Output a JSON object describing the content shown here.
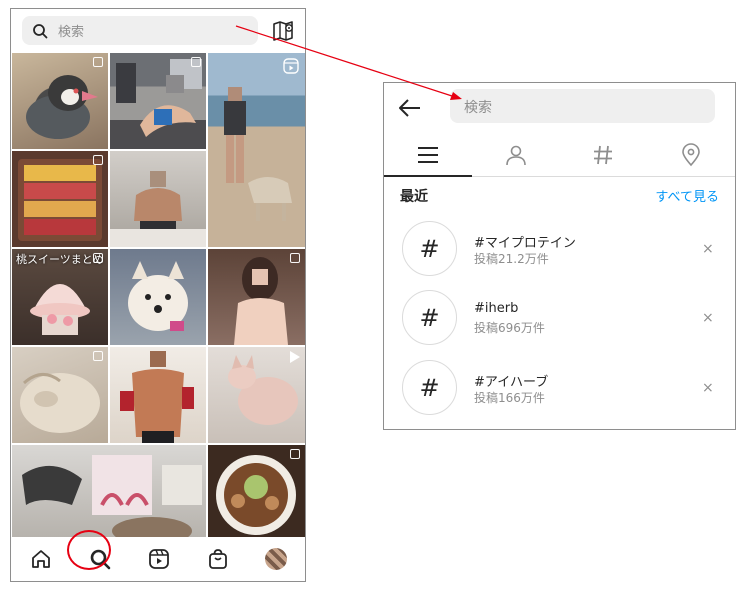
{
  "left_screen": {
    "search_placeholder": "検索",
    "tile_caption": "桃スイーツまとめ",
    "bottom_nav": [
      "home-icon",
      "search-icon",
      "reels-icon",
      "shop-icon",
      "profile-avatar"
    ]
  },
  "right_panel": {
    "search_placeholder": "検索",
    "tabs": [
      "top-icon",
      "accounts-icon",
      "tags-icon",
      "places-icon"
    ],
    "recent_label": "最近",
    "see_all": "すべて見る",
    "history": [
      {
        "tag": "#マイプロテイン",
        "count": "投稿21.2万件"
      },
      {
        "tag": "#iherb",
        "count": "投稿696万件"
      },
      {
        "tag": "#アイハーブ",
        "count": "投稿166万件"
      }
    ],
    "hash_symbol": "#",
    "remove_symbol": "×"
  },
  "colors": {
    "accent_blue": "#0095f6",
    "annotation_red": "#e60012",
    "field_bg": "#efefef"
  }
}
